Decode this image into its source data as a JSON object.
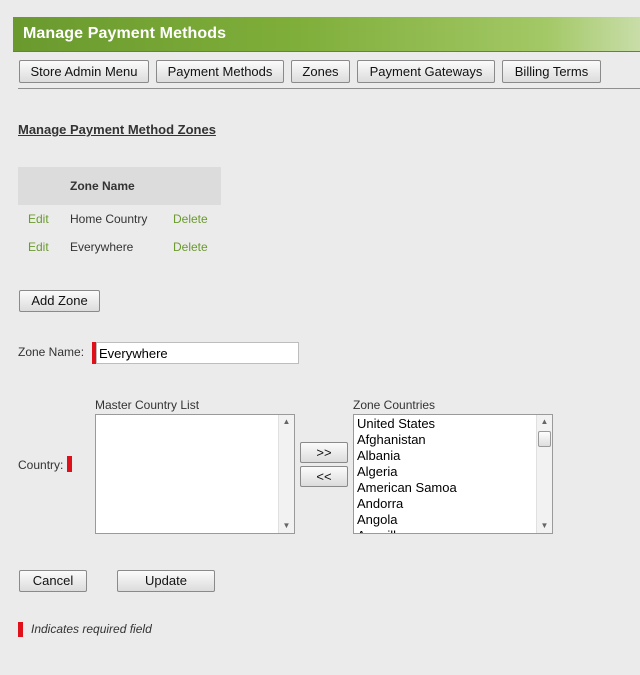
{
  "header": {
    "title": "Manage Payment Methods"
  },
  "tabs": [
    {
      "label": "Store Admin Menu"
    },
    {
      "label": "Payment Methods"
    },
    {
      "label": "Zones"
    },
    {
      "label": "Payment Gateways"
    },
    {
      "label": "Billing Terms"
    }
  ],
  "section": {
    "title": "Manage Payment Method Zones"
  },
  "zone_table": {
    "column_header": "Zone Name",
    "rows": [
      {
        "edit": "Edit",
        "name": "Home Country",
        "delete": "Delete"
      },
      {
        "edit": "Edit",
        "name": "Everywhere",
        "delete": "Delete"
      }
    ]
  },
  "add_zone_label": "Add Zone",
  "form": {
    "zone_name_label": "Zone Name:",
    "zone_name_value": "Everywhere",
    "country_label": "Country:",
    "master_list_label": "Master Country List",
    "master_list_items": [],
    "zone_countries_label": "Zone Countries",
    "zone_countries_items": [
      "United States",
      "Afghanistan",
      "Albania",
      "Algeria",
      "American Samoa",
      "Andorra",
      "Angola",
      "Anguilla"
    ],
    "add_arrow_label": ">>",
    "remove_arrow_label": "<<",
    "cancel_label": "Cancel",
    "update_label": "Update"
  },
  "legend": {
    "text": "Indicates required field"
  },
  "colors": {
    "accent_green": "#6b9a2e",
    "required_red": "#e0101a"
  }
}
